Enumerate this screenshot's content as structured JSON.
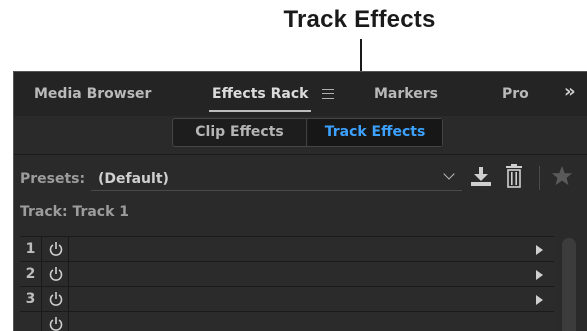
{
  "callout": {
    "label": "Track Effects"
  },
  "tabs": [
    {
      "label": "Media Browser"
    },
    {
      "label": "Effects Rack"
    },
    {
      "label": "Markers"
    },
    {
      "label": "Pro"
    }
  ],
  "segmented": {
    "clip": "Clip Effects",
    "track": "Track Effects",
    "selected": "Track Effects"
  },
  "presets": {
    "label": "Presets:",
    "value": "(Default)"
  },
  "track": {
    "label": "Track: Track 1"
  },
  "rack_rows": [
    "1",
    "2",
    "3"
  ],
  "colors": {
    "accent": "#3da2ff",
    "panel_bg": "#2a2a2a"
  },
  "icons": [
    "menu-icon",
    "overflow-chevron-icon",
    "chevron-down-icon",
    "save-download-icon",
    "trash-icon",
    "star-icon",
    "power-icon",
    "play-arrow-icon"
  ]
}
